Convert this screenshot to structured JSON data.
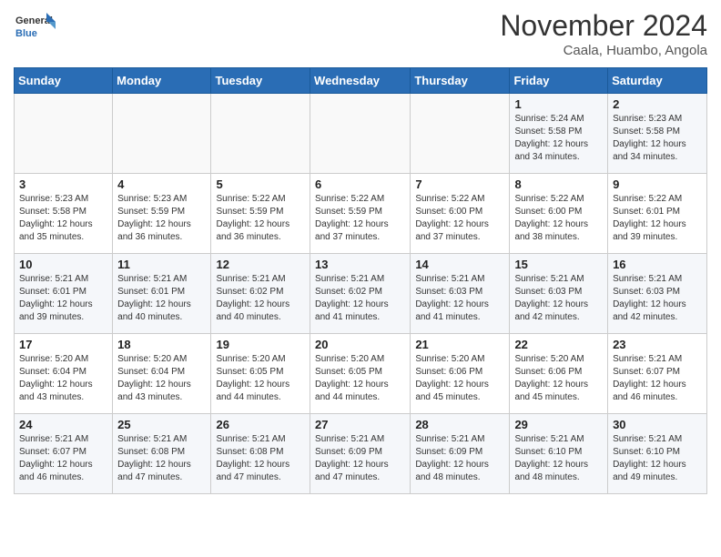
{
  "header": {
    "logo_general": "General",
    "logo_blue": "Blue",
    "month_title": "November 2024",
    "location": "Caala, Huambo, Angola"
  },
  "weekdays": [
    "Sunday",
    "Monday",
    "Tuesday",
    "Wednesday",
    "Thursday",
    "Friday",
    "Saturday"
  ],
  "weeks": [
    [
      {
        "day": "",
        "detail": ""
      },
      {
        "day": "",
        "detail": ""
      },
      {
        "day": "",
        "detail": ""
      },
      {
        "day": "",
        "detail": ""
      },
      {
        "day": "",
        "detail": ""
      },
      {
        "day": "1",
        "detail": "Sunrise: 5:24 AM\nSunset: 5:58 PM\nDaylight: 12 hours\nand 34 minutes."
      },
      {
        "day": "2",
        "detail": "Sunrise: 5:23 AM\nSunset: 5:58 PM\nDaylight: 12 hours\nand 34 minutes."
      }
    ],
    [
      {
        "day": "3",
        "detail": "Sunrise: 5:23 AM\nSunset: 5:58 PM\nDaylight: 12 hours\nand 35 minutes."
      },
      {
        "day": "4",
        "detail": "Sunrise: 5:23 AM\nSunset: 5:59 PM\nDaylight: 12 hours\nand 36 minutes."
      },
      {
        "day": "5",
        "detail": "Sunrise: 5:22 AM\nSunset: 5:59 PM\nDaylight: 12 hours\nand 36 minutes."
      },
      {
        "day": "6",
        "detail": "Sunrise: 5:22 AM\nSunset: 5:59 PM\nDaylight: 12 hours\nand 37 minutes."
      },
      {
        "day": "7",
        "detail": "Sunrise: 5:22 AM\nSunset: 6:00 PM\nDaylight: 12 hours\nand 37 minutes."
      },
      {
        "day": "8",
        "detail": "Sunrise: 5:22 AM\nSunset: 6:00 PM\nDaylight: 12 hours\nand 38 minutes."
      },
      {
        "day": "9",
        "detail": "Sunrise: 5:22 AM\nSunset: 6:01 PM\nDaylight: 12 hours\nand 39 minutes."
      }
    ],
    [
      {
        "day": "10",
        "detail": "Sunrise: 5:21 AM\nSunset: 6:01 PM\nDaylight: 12 hours\nand 39 minutes."
      },
      {
        "day": "11",
        "detail": "Sunrise: 5:21 AM\nSunset: 6:01 PM\nDaylight: 12 hours\nand 40 minutes."
      },
      {
        "day": "12",
        "detail": "Sunrise: 5:21 AM\nSunset: 6:02 PM\nDaylight: 12 hours\nand 40 minutes."
      },
      {
        "day": "13",
        "detail": "Sunrise: 5:21 AM\nSunset: 6:02 PM\nDaylight: 12 hours\nand 41 minutes."
      },
      {
        "day": "14",
        "detail": "Sunrise: 5:21 AM\nSunset: 6:03 PM\nDaylight: 12 hours\nand 41 minutes."
      },
      {
        "day": "15",
        "detail": "Sunrise: 5:21 AM\nSunset: 6:03 PM\nDaylight: 12 hours\nand 42 minutes."
      },
      {
        "day": "16",
        "detail": "Sunrise: 5:21 AM\nSunset: 6:03 PM\nDaylight: 12 hours\nand 42 minutes."
      }
    ],
    [
      {
        "day": "17",
        "detail": "Sunrise: 5:20 AM\nSunset: 6:04 PM\nDaylight: 12 hours\nand 43 minutes."
      },
      {
        "day": "18",
        "detail": "Sunrise: 5:20 AM\nSunset: 6:04 PM\nDaylight: 12 hours\nand 43 minutes."
      },
      {
        "day": "19",
        "detail": "Sunrise: 5:20 AM\nSunset: 6:05 PM\nDaylight: 12 hours\nand 44 minutes."
      },
      {
        "day": "20",
        "detail": "Sunrise: 5:20 AM\nSunset: 6:05 PM\nDaylight: 12 hours\nand 44 minutes."
      },
      {
        "day": "21",
        "detail": "Sunrise: 5:20 AM\nSunset: 6:06 PM\nDaylight: 12 hours\nand 45 minutes."
      },
      {
        "day": "22",
        "detail": "Sunrise: 5:20 AM\nSunset: 6:06 PM\nDaylight: 12 hours\nand 45 minutes."
      },
      {
        "day": "23",
        "detail": "Sunrise: 5:21 AM\nSunset: 6:07 PM\nDaylight: 12 hours\nand 46 minutes."
      }
    ],
    [
      {
        "day": "24",
        "detail": "Sunrise: 5:21 AM\nSunset: 6:07 PM\nDaylight: 12 hours\nand 46 minutes."
      },
      {
        "day": "25",
        "detail": "Sunrise: 5:21 AM\nSunset: 6:08 PM\nDaylight: 12 hours\nand 47 minutes."
      },
      {
        "day": "26",
        "detail": "Sunrise: 5:21 AM\nSunset: 6:08 PM\nDaylight: 12 hours\nand 47 minutes."
      },
      {
        "day": "27",
        "detail": "Sunrise: 5:21 AM\nSunset: 6:09 PM\nDaylight: 12 hours\nand 47 minutes."
      },
      {
        "day": "28",
        "detail": "Sunrise: 5:21 AM\nSunset: 6:09 PM\nDaylight: 12 hours\nand 48 minutes."
      },
      {
        "day": "29",
        "detail": "Sunrise: 5:21 AM\nSunset: 6:10 PM\nDaylight: 12 hours\nand 48 minutes."
      },
      {
        "day": "30",
        "detail": "Sunrise: 5:21 AM\nSunset: 6:10 PM\nDaylight: 12 hours\nand 49 minutes."
      }
    ]
  ]
}
